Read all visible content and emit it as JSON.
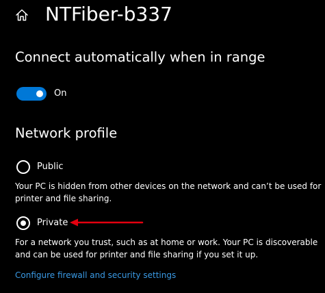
{
  "header": {
    "title": "NTFiber-b337",
    "home_icon": "home-icon"
  },
  "auto_connect": {
    "heading": "Connect automatically when in range",
    "toggle_state_label": "On",
    "toggle_on": true,
    "accent_color": "#0078d7"
  },
  "network_profile": {
    "heading": "Network profile",
    "options": [
      {
        "label": "Public",
        "selected": false,
        "description": "Your PC is hidden from other devices on the network and can’t be used for printer and file sharing."
      },
      {
        "label": "Private",
        "selected": true,
        "description": "For a network you trust, such as at home or work. Your PC is discoverable and can be used for printer and file sharing if you set it up."
      }
    ]
  },
  "firewall_link": {
    "label": "Configure firewall and security settings",
    "color": "#3a9ae5"
  },
  "annotation": {
    "arrow_color": "#e3000f",
    "points_to": "Private"
  },
  "theme": {
    "background": "#000000",
    "text": "#ffffff"
  }
}
